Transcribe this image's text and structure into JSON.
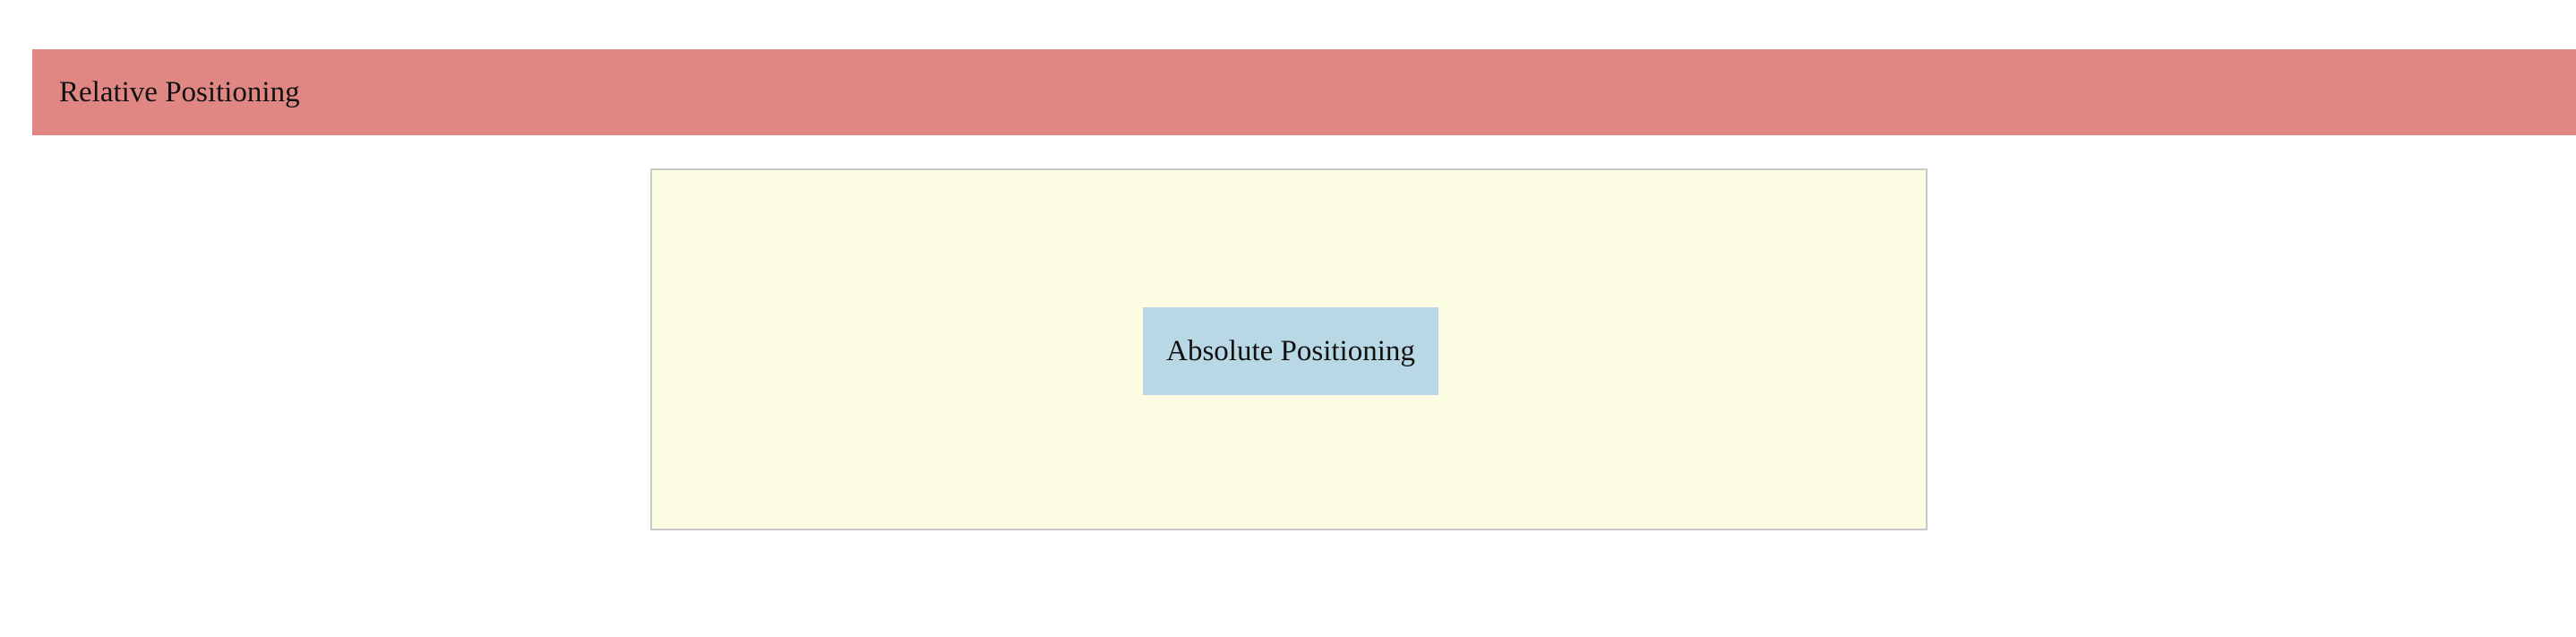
{
  "relative": {
    "label": "Relative Positioning"
  },
  "absolute": {
    "label": "Absolute Positioning"
  },
  "colors": {
    "relative_bg": "#e08783",
    "container_bg": "#fdfde3",
    "container_border": "#c9c9c9",
    "absolute_bg": "#b7d8e4"
  }
}
